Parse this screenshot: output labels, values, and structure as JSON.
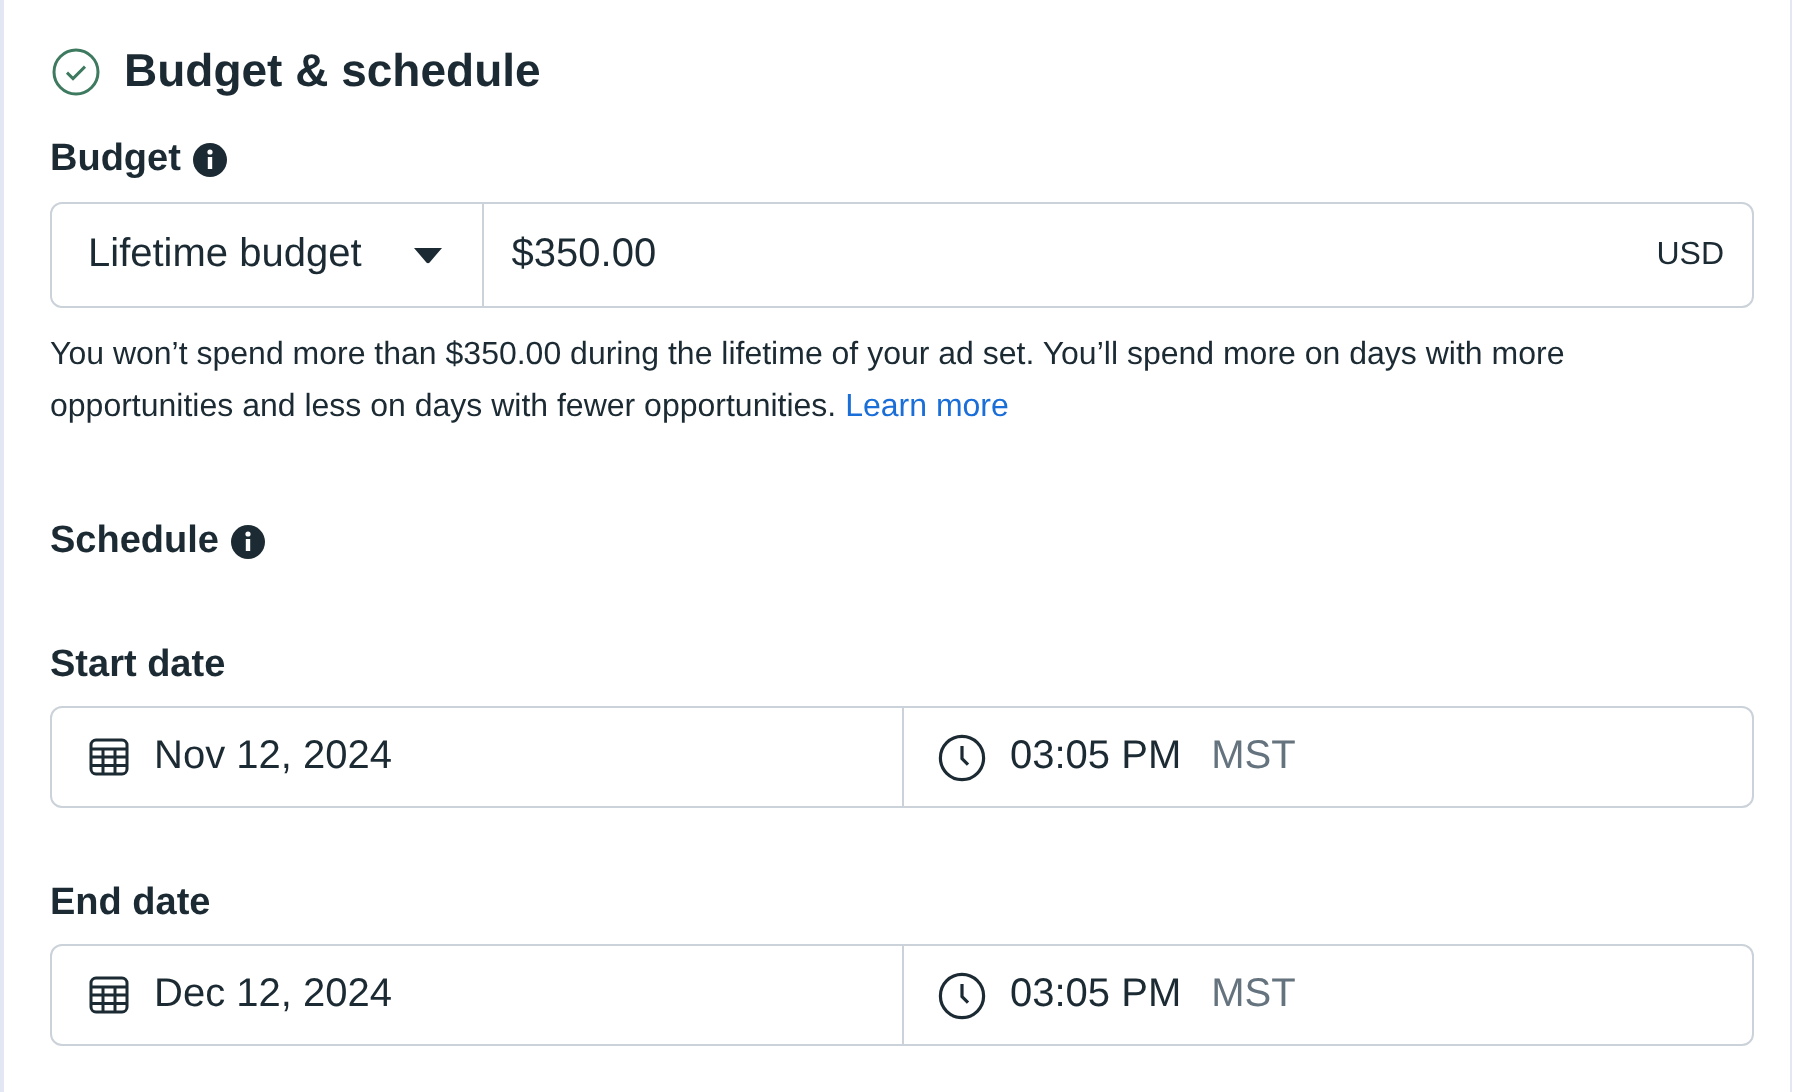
{
  "section": {
    "title": "Budget & schedule"
  },
  "budget": {
    "label": "Budget",
    "type": "Lifetime budget",
    "amount": "$350.00",
    "currency": "USD",
    "description": "You won’t spend more than $350.00 during the lifetime of your ad set. You’ll spend more on days with more opportunities and less on days with fewer opportunities.",
    "link": "Learn more"
  },
  "schedule": {
    "label": "Schedule",
    "dates": [
      {
        "label": "Start date",
        "date": "Nov 12, 2024",
        "time": "03:05 PM",
        "timezone": "MST"
      },
      {
        "label": "End date",
        "date": "Dec 12, 2024",
        "time": "03:05 PM",
        "timezone": "MST"
      }
    ]
  }
}
